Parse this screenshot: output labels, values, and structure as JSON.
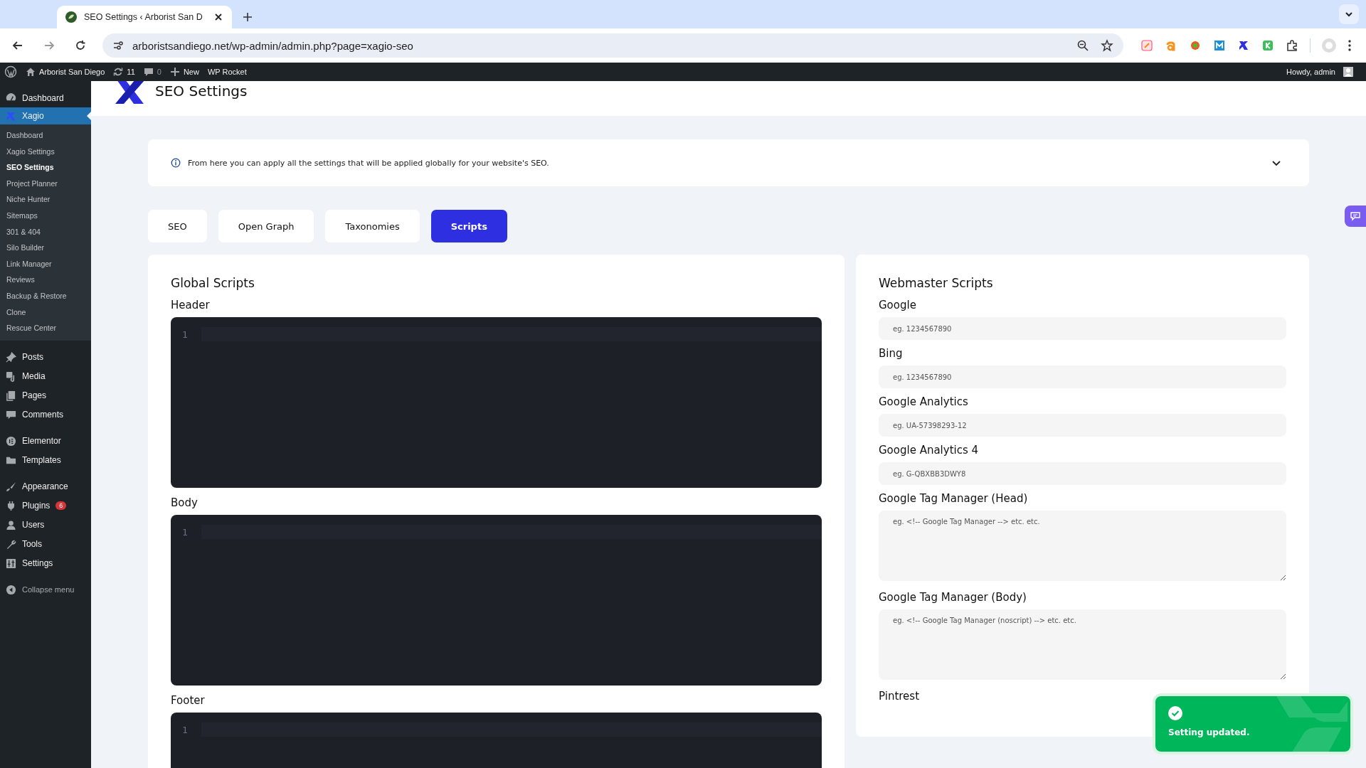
{
  "browser": {
    "tab_title": "SEO Settings ‹ Arborist San D",
    "url": "arboristsandiego.net/wp-admin/admin.php?page=xagio-seo"
  },
  "admin_bar": {
    "site": "Arborist San Diego",
    "updates": "11",
    "comments": "0",
    "new": "New",
    "plugin": "WP Rocket",
    "howdy": "Howdy, admin"
  },
  "sidebar": {
    "groups": [
      [
        {
          "label": "Dashboard",
          "selected": false
        },
        {
          "label": "Xagio",
          "selected": true,
          "children": [
            {
              "label": "Dashboard",
              "selected": false
            },
            {
              "label": "Xagio Settings",
              "selected": false
            },
            {
              "label": "SEO Settings",
              "selected": true
            },
            {
              "label": "Project Planner",
              "selected": false
            },
            {
              "label": "Niche Hunter",
              "selected": false
            },
            {
              "label": "Sitemaps",
              "selected": false
            },
            {
              "label": "301 & 404",
              "selected": false
            },
            {
              "label": "Silo Builder",
              "selected": false
            },
            {
              "label": "Link Manager",
              "selected": false
            },
            {
              "label": "Reviews",
              "selected": false
            },
            {
              "label": "Backup & Restore",
              "selected": false
            },
            {
              "label": "Clone",
              "selected": false
            },
            {
              "label": "Rescue Center",
              "selected": false
            }
          ]
        }
      ],
      [
        {
          "label": "Posts",
          "selected": false
        },
        {
          "label": "Media",
          "selected": false
        },
        {
          "label": "Pages",
          "selected": false
        },
        {
          "label": "Comments",
          "selected": false
        }
      ],
      [
        {
          "label": "Elementor",
          "selected": false
        },
        {
          "label": "Templates",
          "selected": false
        }
      ],
      [
        {
          "label": "Appearance",
          "selected": false
        },
        {
          "label": "Plugins",
          "selected": false,
          "badge": "6"
        },
        {
          "label": "Users",
          "selected": false
        },
        {
          "label": "Tools",
          "selected": false
        },
        {
          "label": "Settings",
          "selected": false
        }
      ]
    ],
    "collapse": "Collapse menu"
  },
  "page": {
    "title": "SEO Settings",
    "notice": {
      "text": "From here you can apply all the settings that will be applied globally for your website's SEO.",
      "expanded": false
    },
    "tabs": [
      {
        "label": "SEO",
        "selected": false
      },
      {
        "label": "Open Graph",
        "selected": false
      },
      {
        "label": "Taxonomies",
        "selected": false
      },
      {
        "label": "Scripts",
        "selected": true
      }
    ],
    "global_scripts": {
      "title": "Global Scripts",
      "editors": [
        {
          "label": "Header",
          "line_number": "1"
        },
        {
          "label": "Body",
          "line_number": "1"
        },
        {
          "label": "Footer",
          "line_number": "1"
        }
      ]
    },
    "webmaster_scripts": {
      "title": "Webmaster Scripts",
      "fields": [
        {
          "label": "Google",
          "kind": "input",
          "placeholder": "eg. 1234567890"
        },
        {
          "label": "Bing",
          "kind": "input",
          "placeholder": "eg. 1234567890"
        },
        {
          "label": "Google Analytics",
          "kind": "input",
          "placeholder": "eg. UA-57398293-12"
        },
        {
          "label": "Google Analytics 4",
          "kind": "input",
          "placeholder": "eg. G-QBXBB3DWY8"
        },
        {
          "label": "Google Tag Manager (Head)",
          "kind": "textarea",
          "placeholder": "eg. <!-- Google Tag Manager --> etc. etc."
        },
        {
          "label": "Google Tag Manager (Body)",
          "kind": "textarea",
          "placeholder": "eg. <!-- Google Tag Manager (noscript) --> etc. etc."
        },
        {
          "label": "Pintrest"
        }
      ]
    }
  },
  "toast": {
    "kind": "success",
    "message": "Setting updated."
  }
}
